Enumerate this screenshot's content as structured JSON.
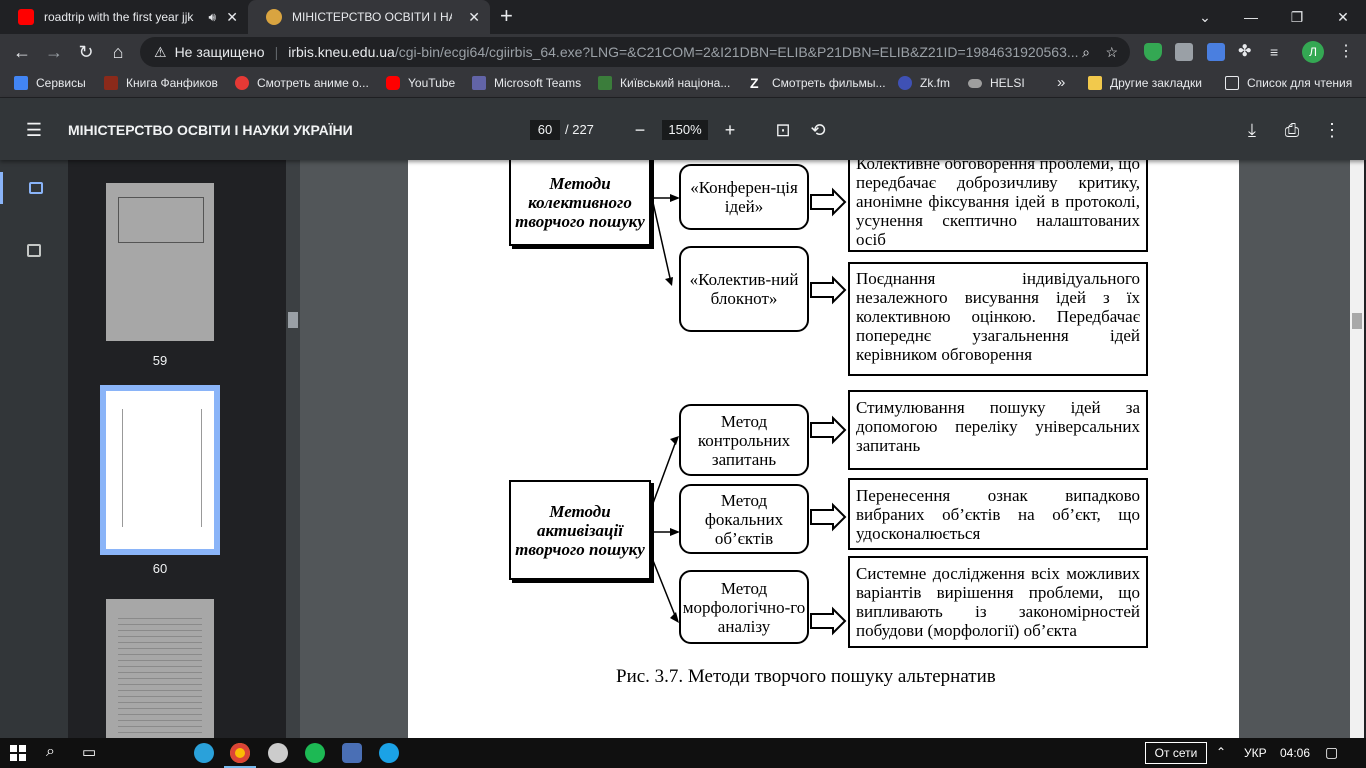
{
  "browser": {
    "tabs": [
      {
        "title": "roadtrip with the first year jjk",
        "favicon_color": "#ff0000"
      },
      {
        "title": "МІНІСТЕРСТВО ОСВІТИ І НАУКИ",
        "favicon_color": "#d9a440"
      }
    ],
    "address": {
      "security": "Не защищено",
      "host": "irbis.kneu.edu.ua",
      "path": "/cgi-bin/ecgi64/cgiirbis_64.exe?LNG=&C21COM=2&I21DBN=ELIB&P21DBN=ELIB&Z21ID=1984631920563..."
    },
    "profile_initial": "Л",
    "bookmarks": [
      {
        "label": "Сервисы",
        "icon": "apps-grid-icon",
        "color": "#4285f4"
      },
      {
        "label": "Книга Фанфиков",
        "icon": "quill-icon",
        "color": "#8b2a1a"
      },
      {
        "label": "Смотреть аниме о...",
        "icon": "anime-logo-icon",
        "color": "#e53935"
      },
      {
        "label": "YouTube",
        "icon": "youtube-icon",
        "color": "#ff0000"
      },
      {
        "label": "Microsoft Teams",
        "icon": "teams-icon",
        "color": "#6264a7"
      },
      {
        "label": "Київський націона...",
        "icon": "university-icon",
        "color": "#3b7d3b"
      },
      {
        "label": "Смотреть фильмы...",
        "icon": "z-logo-icon",
        "color": "#ffffff"
      },
      {
        "label": "Zk.fm",
        "icon": "zkfm-icon",
        "color": "#3f51b5"
      },
      {
        "label": "HELSI",
        "icon": "cloud-icon",
        "color": "#9e9e9e"
      },
      {
        "label": "»",
        "icon": "more-bookmarks-icon",
        "color": "#e8eaed"
      },
      {
        "label": "Другие закладки",
        "icon": "folder-icon",
        "color": "#f2c94c"
      },
      {
        "label": "Список для чтения",
        "icon": "reading-list-icon",
        "color": "#e8eaed"
      }
    ]
  },
  "pdf": {
    "title": "МІНІСТЕРСТВО ОСВІТИ І НАУКИ УКРАЇНИ",
    "page_current": "60",
    "page_total": "/ 227",
    "zoom": "150%",
    "thumbnails": [
      {
        "label": "59",
        "selected": false
      },
      {
        "label": "60",
        "selected": true
      },
      {
        "label": "",
        "selected": false
      }
    ]
  },
  "document": {
    "groups": [
      {
        "name": "Методи колективного творчого пошуку",
        "methods": [
          {
            "name": "«Конферен-ція ідей»",
            "description": "Колективне обговорення проблеми, що передбачає доброзичливу критику, анонімне фіксування ідей в протоколі, усунення скептично налаштованих осіб"
          },
          {
            "name": "«Колектив-ний блокнот»",
            "description": "Поєднання індивідуального незалежного висування ідей з їх колективною оцінкою. Передбачає попереднє узагальнення ідей керівником обговорення"
          }
        ]
      },
      {
        "name": "Методи активізації творчого пошуку",
        "methods": [
          {
            "name": "Метод контрольних запитань",
            "description": "Стимулювання пошуку ідей за допомогою переліку універсальних запитань"
          },
          {
            "name": "Метод фокальних об’єктів",
            "description": "Перенесення ознак випадково вибраних об’єктів на об’єкт, що удосконалюється"
          },
          {
            "name": "Метод морфологічно-го аналізу",
            "description": "Системне дослідження всіх можливих варіантів вирішення проблеми, що випливають із закономірностей побудови (морфології) об’єкта"
          }
        ]
      }
    ],
    "caption": "Рис. 3.7. Методи творчого пошуку альтернатив"
  },
  "taskbar": {
    "network": "От сети",
    "language": "УКР",
    "time": "04:06",
    "apps": [
      {
        "icon": "telegram-icon",
        "color": "#2aa1da"
      },
      {
        "icon": "chrome-icon",
        "color": "#fbbc05"
      },
      {
        "icon": "obs-icon",
        "color": "#cccccc"
      },
      {
        "icon": "spotify-icon",
        "color": "#1db954"
      },
      {
        "icon": "word-icon",
        "color": "#4a6fb5"
      },
      {
        "icon": "edge-icon",
        "color": "#1ba2e6"
      }
    ]
  }
}
